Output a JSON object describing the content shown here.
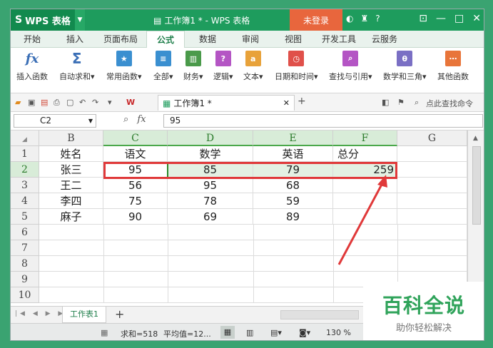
{
  "window": {
    "app_label": "WPS 表格",
    "doc_title": "工作簿1 * - WPS 表格",
    "login_label": "未登录",
    "help_label": "?"
  },
  "menu": {
    "tabs": [
      "开始",
      "插入",
      "页面布局",
      "公式",
      "数据",
      "审阅",
      "视图",
      "开发工具",
      "云服务"
    ],
    "active": "公式"
  },
  "ribbon": {
    "buttons": [
      {
        "label": "插入函数",
        "icon": "fx-icon",
        "color": "#3b6fb6"
      },
      {
        "label": "自动求和",
        "icon": "sigma-icon",
        "color": "#3b6fb6"
      },
      {
        "label": "常用函数",
        "icon": "star-icon",
        "color": "#3a8fd0"
      },
      {
        "label": "全部",
        "icon": "list-icon",
        "color": "#3a8fd0"
      },
      {
        "label": "财务",
        "icon": "book-icon",
        "color": "#4a9a4a"
      },
      {
        "label": "逻辑",
        "icon": "question-icon",
        "color": "#b455c4"
      },
      {
        "label": "文本",
        "icon": "text-icon",
        "color": "#e8a23a"
      },
      {
        "label": "日期和时间",
        "icon": "clock-icon",
        "color": "#e0504a"
      },
      {
        "label": "查找与引用",
        "icon": "search-icon",
        "color": "#b455c4"
      },
      {
        "label": "数学和三角",
        "icon": "theta-icon",
        "color": "#7a6fc4"
      },
      {
        "label": "其他函数",
        "icon": "more-icon",
        "color": "#e8753a"
      }
    ]
  },
  "quickbar": {
    "doc_tab": "工作簿1 *",
    "find_label": "点此查找命令"
  },
  "formula": {
    "name_box": "C2",
    "fx": "fx",
    "value": "95"
  },
  "grid": {
    "columns": [
      "B",
      "C",
      "D",
      "E",
      "F",
      "G"
    ],
    "selected_columns": [
      "C",
      "D",
      "E",
      "F"
    ],
    "rows": [
      "1",
      "2",
      "3",
      "4",
      "5",
      "6",
      "7",
      "8",
      "9",
      "10"
    ],
    "selected_row": "2",
    "data": [
      [
        "姓名",
        "语文",
        "数学",
        "英语",
        "总分",
        ""
      ],
      [
        "张三",
        "95",
        "85",
        "79",
        "259",
        ""
      ],
      [
        "王二",
        "56",
        "95",
        "68",
        "",
        ""
      ],
      [
        "李四",
        "75",
        "78",
        "59",
        "",
        ""
      ],
      [
        "麻子",
        "90",
        "69",
        "89",
        "",
        ""
      ]
    ]
  },
  "sheets": {
    "active": "工作表1",
    "add": "+"
  },
  "status": {
    "sum": "求和=518",
    "avg": "平均值=12...",
    "zoom": "130 %"
  },
  "watermark": {
    "title": "百科全说",
    "subtitle": "助你轻松解决"
  },
  "colors": {
    "title_green": "#1e9c5d",
    "highlight_red": "#e0393a",
    "selected_green": "#e3f1e3"
  }
}
